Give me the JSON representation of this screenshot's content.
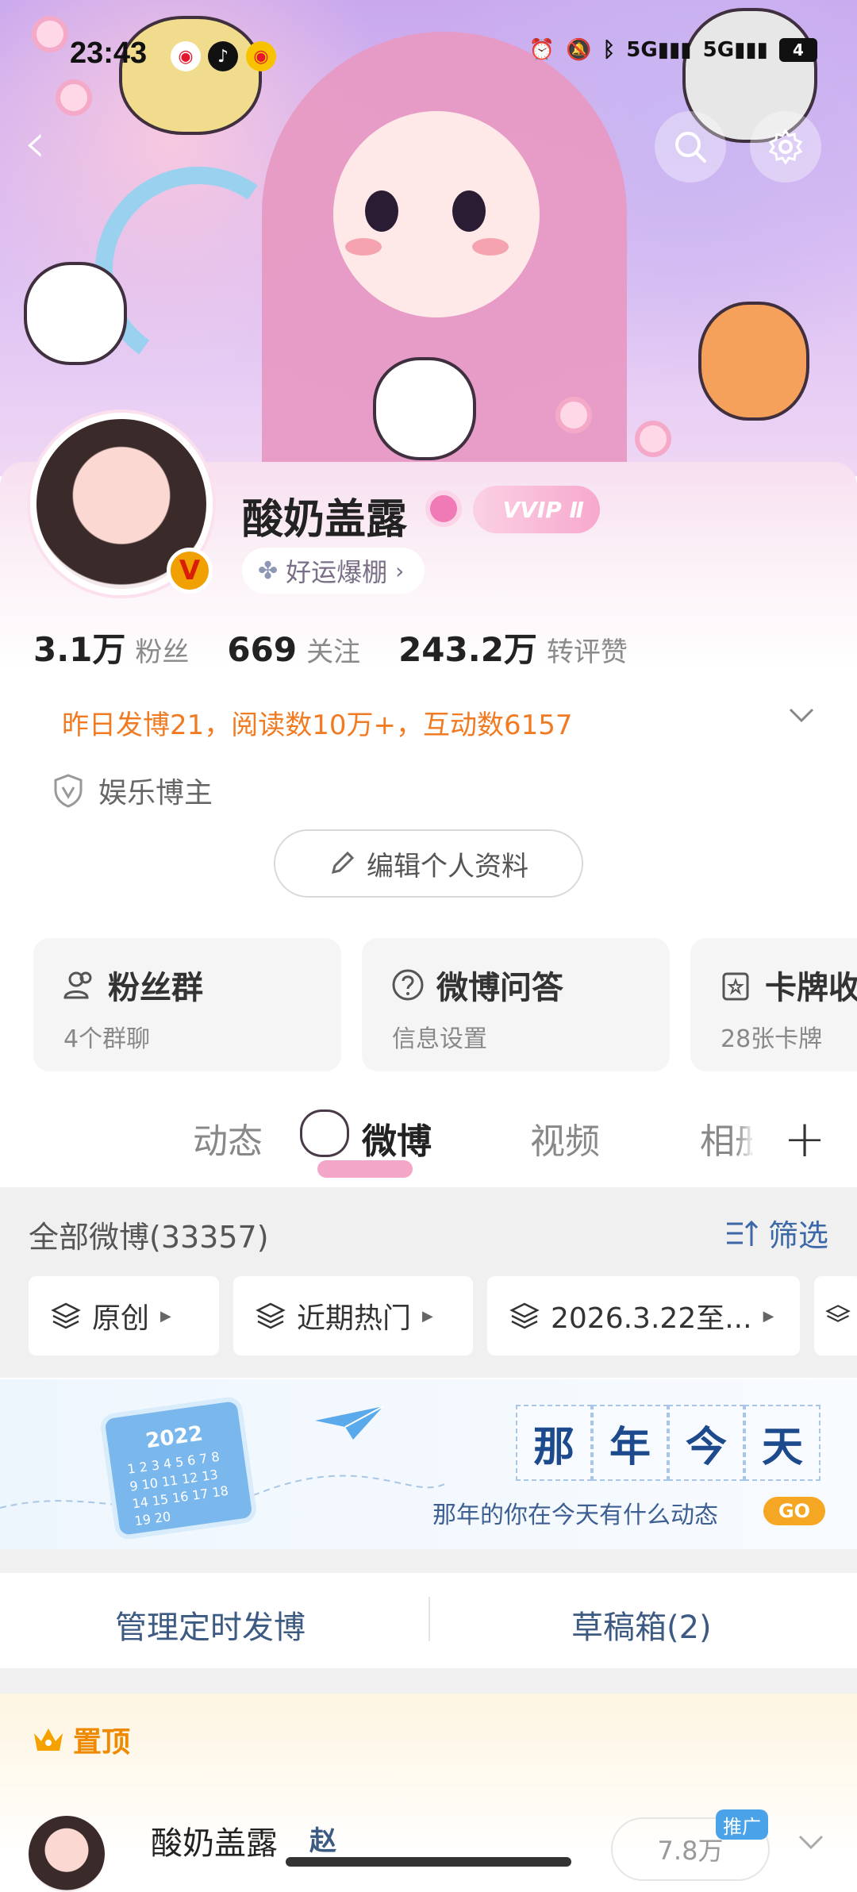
{
  "status_bar": {
    "time": "23:43",
    "network_1": "5G",
    "network_2": "5G",
    "battery": "4"
  },
  "profile": {
    "username": "酸奶盖露",
    "vvip_label": "VVIP Ⅱ",
    "luck_label": "好运爆棚",
    "verified_mark": "V",
    "stats": [
      {
        "value": "3.1万",
        "label": "粉丝"
      },
      {
        "value": "669",
        "label": "关注"
      },
      {
        "value": "243.2万",
        "label": "转评赞"
      }
    ],
    "activity_line": "昨日发博21，阅读数10万+，互动数6157",
    "tag": "娱乐博主",
    "edit_label": "编辑个人资料"
  },
  "features": [
    {
      "title": "粉丝群",
      "subtitle": "4个群聊",
      "icon": "users-icon"
    },
    {
      "title": "微博问答",
      "subtitle": "信息设置",
      "icon": "question-icon"
    },
    {
      "title": "卡牌收",
      "subtitle": "28张卡牌",
      "icon": "card-icon"
    }
  ],
  "tabs": [
    {
      "label": "动态",
      "active": false
    },
    {
      "label": "微博",
      "active": true
    },
    {
      "label": "视频",
      "active": false
    },
    {
      "label": "相册",
      "active": false
    }
  ],
  "posts_header": {
    "all_label": "全部微博(33357)",
    "filter_label": "筛选"
  },
  "chips": [
    {
      "label": "原创"
    },
    {
      "label": "近期热门"
    },
    {
      "label": "2026.3.22至..."
    },
    {
      "label": ""
    }
  ],
  "memory_banner": {
    "chars": [
      "那",
      "年",
      "今",
      "天"
    ],
    "subtitle": "那年的你在今天有什么动态",
    "go_label": "GO",
    "calendar_year": "2022",
    "calendar_digits": "1 2 3 4 5 6 7 8 9 10 11 12 13 14 15 16 17 18 19 20"
  },
  "manage": {
    "scheduled_label": "管理定时发博",
    "drafts_label": "草稿箱(2)"
  },
  "pinned": {
    "label": "置顶",
    "name": "酸奶盖露",
    "extra": "赵",
    "promo_label": "推广",
    "count_label": "7.8万"
  },
  "colors": {
    "accent_orange": "#f07b22",
    "link_blue": "#3c68a8",
    "pin_orange": "#ef8a00"
  }
}
